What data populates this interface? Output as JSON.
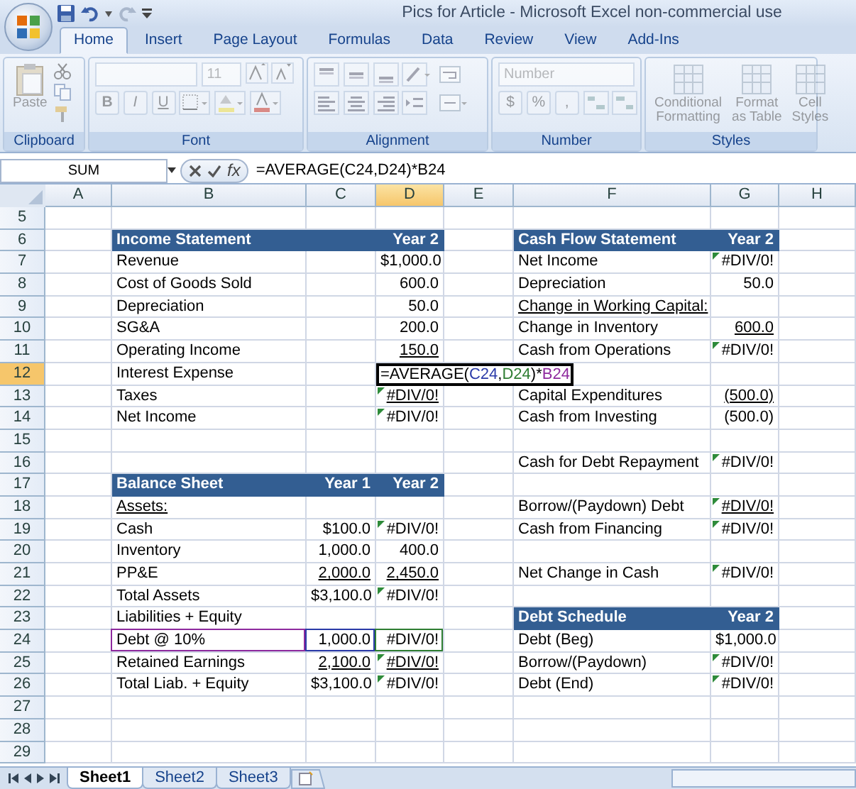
{
  "window": {
    "title": "Pics for Article - Microsoft Excel non-commercial use"
  },
  "tabs": [
    {
      "label": "Home",
      "selected": true
    },
    {
      "label": "Insert",
      "selected": false
    },
    {
      "label": "Page Layout",
      "selected": false
    },
    {
      "label": "Formulas",
      "selected": false
    },
    {
      "label": "Data",
      "selected": false
    },
    {
      "label": "Review",
      "selected": false
    },
    {
      "label": "View",
      "selected": false
    },
    {
      "label": "Add-Ins",
      "selected": false
    }
  ],
  "ribbon": {
    "disabled": true,
    "groups": [
      {
        "kind": "clipboard",
        "label": "Clipboard",
        "paste": "Paste"
      },
      {
        "kind": "font",
        "label": "Font",
        "font_size": "11",
        "bold": "B",
        "italic": "I",
        "underline": "U"
      },
      {
        "kind": "alignment",
        "label": "Alignment"
      },
      {
        "kind": "number",
        "label": "Number",
        "format": "Number",
        "currency": "$",
        "percent": "%",
        "comma": ","
      },
      {
        "kind": "styles",
        "label": "Styles",
        "buttons": [
          [
            "Conditional",
            "Formatting"
          ],
          [
            "Format",
            "as Table"
          ],
          [
            "Cell",
            "Styles"
          ]
        ]
      }
    ]
  },
  "formula_bar": {
    "name_box": "SUM",
    "fx": "fx",
    "formula": "=AVERAGE(C24,D24)*B24"
  },
  "columns": [
    {
      "label": "A",
      "selected": false
    },
    {
      "label": "B",
      "selected": false
    },
    {
      "label": "C",
      "selected": false
    },
    {
      "label": "D",
      "selected": true
    },
    {
      "label": "E",
      "selected": false
    },
    {
      "label": "F",
      "selected": false
    },
    {
      "label": "G",
      "selected": false
    },
    {
      "label": "H",
      "selected": false
    }
  ],
  "grid": {
    "rows": [
      {
        "row": "5",
        "selected": false,
        "cells": []
      },
      {
        "row": "6",
        "selected": false,
        "cells": [
          "",
          {
            "kind": "header",
            "text": "Income Statement"
          },
          {
            "kind": "header"
          },
          {
            "kind": "header",
            "text": "Year 2"
          },
          "",
          {
            "kind": "header",
            "text": "Cash Flow Statement"
          },
          {
            "kind": "header",
            "text": "Year 2"
          }
        ]
      },
      {
        "row": "7",
        "selected": false,
        "cells": [
          "",
          {
            "kind": "label",
            "text": "Revenue"
          },
          "",
          {
            "kind": "number",
            "text": "$1,000.0"
          },
          "",
          {
            "kind": "label",
            "text": "Net Income"
          },
          {
            "kind": "number",
            "text": "#DIV/0!",
            "flag": true
          }
        ]
      },
      {
        "row": "8",
        "selected": false,
        "cells": [
          "",
          {
            "kind": "label",
            "text": "Cost of Goods Sold"
          },
          "",
          {
            "kind": "number",
            "text": "600.0"
          },
          "",
          {
            "kind": "label",
            "text": "Depreciation"
          },
          {
            "kind": "number",
            "text": "50.0"
          }
        ]
      },
      {
        "row": "9",
        "selected": false,
        "cells": [
          "",
          {
            "kind": "label",
            "text": "Depreciation"
          },
          "",
          {
            "kind": "number",
            "text": "50.0"
          },
          "",
          {
            "kind": "label",
            "text": "Change in Working Capital:",
            "underline": true
          }
        ]
      },
      {
        "row": "10",
        "selected": false,
        "cells": [
          "",
          {
            "kind": "label",
            "text": "SG&A"
          },
          "",
          {
            "kind": "number",
            "text": "200.0"
          },
          "",
          {
            "kind": "label",
            "text": "Change in Inventory"
          },
          {
            "kind": "number",
            "text": "600.0",
            "underline": true
          }
        ]
      },
      {
        "row": "11",
        "selected": false,
        "cells": [
          "",
          {
            "kind": "label",
            "text": "Operating Income"
          },
          "",
          {
            "kind": "number",
            "text": "150.0",
            "underline": true
          },
          "",
          {
            "kind": "label",
            "text": "Cash from Operations"
          },
          {
            "kind": "number",
            "text": "#DIV/0!",
            "flag": true
          }
        ]
      },
      {
        "row": "12",
        "selected": true,
        "cells": [
          "",
          {
            "kind": "label",
            "text": "Interest Expense"
          },
          "",
          {
            "kind": "editing",
            "parts": [
              {
                "text": "=AVERAGE(",
                "color": "#000000"
              },
              {
                "text": "C24",
                "color": "#2a3aa8"
              },
              {
                "text": ",",
                "color": "#000000"
              },
              {
                "text": "D24",
                "color": "#2e7d32"
              },
              {
                "text": ")*",
                "color": "#000000"
              },
              {
                "text": "B24",
                "color": "#8e2a9e"
              }
            ]
          }
        ]
      },
      {
        "row": "13",
        "selected": false,
        "cells": [
          "",
          {
            "kind": "label",
            "text": "Taxes"
          },
          "",
          {
            "kind": "number",
            "text": "#DIV/0!",
            "underline": true,
            "flag": true
          },
          "",
          {
            "kind": "label",
            "text": "Capital Expenditures"
          },
          {
            "kind": "number",
            "text": "(500.0)",
            "underline": true
          }
        ]
      },
      {
        "row": "14",
        "selected": false,
        "cells": [
          "",
          {
            "kind": "label",
            "text": "Net Income"
          },
          "",
          {
            "kind": "number",
            "text": "#DIV/0!",
            "flag": true
          },
          "",
          {
            "kind": "label",
            "text": "Cash from Investing"
          },
          {
            "kind": "number",
            "text": "(500.0)"
          }
        ]
      },
      {
        "row": "15",
        "selected": false,
        "cells": []
      },
      {
        "row": "16",
        "selected": false,
        "cells": [
          "",
          "",
          "",
          "",
          "",
          {
            "kind": "label",
            "text": "Cash for Debt Repayment"
          },
          {
            "kind": "number",
            "text": "#DIV/0!",
            "flag": true
          }
        ]
      },
      {
        "row": "17",
        "selected": false,
        "cells": [
          "",
          {
            "kind": "header",
            "text": "Balance Sheet"
          },
          {
            "kind": "header",
            "text": "Year 1"
          },
          {
            "kind": "header",
            "text": "Year 2"
          }
        ]
      },
      {
        "row": "18",
        "selected": false,
        "cells": [
          "",
          {
            "kind": "label",
            "text": "Assets:",
            "underline": true
          },
          "",
          "",
          "",
          {
            "kind": "label",
            "text": "Borrow/(Paydown) Debt"
          },
          {
            "kind": "number",
            "text": "#DIV/0!",
            "underline": true,
            "flag": true
          }
        ]
      },
      {
        "row": "19",
        "selected": false,
        "cells": [
          "",
          {
            "kind": "label",
            "text": "Cash"
          },
          {
            "kind": "number",
            "text": "$100.0"
          },
          {
            "kind": "number",
            "text": "#DIV/0!",
            "flag": true
          },
          "",
          {
            "kind": "label",
            "text": "Cash from Financing"
          },
          {
            "kind": "number",
            "text": "#DIV/0!",
            "flag": true
          }
        ]
      },
      {
        "row": "20",
        "selected": false,
        "cells": [
          "",
          {
            "kind": "label",
            "text": "Inventory"
          },
          {
            "kind": "number",
            "text": "1,000.0"
          },
          {
            "kind": "number",
            "text": "400.0"
          }
        ]
      },
      {
        "row": "21",
        "selected": false,
        "cells": [
          "",
          {
            "kind": "label",
            "text": "PP&E"
          },
          {
            "kind": "number",
            "text": "2,000.0",
            "underline": true
          },
          {
            "kind": "number",
            "text": "2,450.0",
            "underline": true
          },
          "",
          {
            "kind": "label",
            "text": "Net Change in Cash"
          },
          {
            "kind": "number",
            "text": "#DIV/0!",
            "flag": true
          }
        ]
      },
      {
        "row": "22",
        "selected": false,
        "cells": [
          "",
          {
            "kind": "label",
            "text": "Total Assets"
          },
          {
            "kind": "number",
            "text": "$3,100.0"
          },
          {
            "kind": "number",
            "text": "#DIV/0!",
            "flag": true
          }
        ]
      },
      {
        "row": "23",
        "selected": false,
        "cells": [
          "",
          {
            "kind": "label",
            "text": "Liabilities + Equity"
          },
          "",
          "",
          "",
          {
            "kind": "header",
            "text": "Debt Schedule"
          },
          {
            "kind": "header",
            "text": "Year 2"
          }
        ]
      },
      {
        "row": "24",
        "selected": false,
        "cells": [
          "",
          {
            "kind": "label",
            "text": "Debt @ 10%",
            "color": "#8e2a9e"
          },
          {
            "kind": "number",
            "text": "1,000.0",
            "color": "#2a3aa8"
          },
          {
            "kind": "number",
            "text": "#DIV/0!",
            "color": "#2e7d32"
          },
          "",
          {
            "kind": "label",
            "text": "Debt (Beg)"
          },
          {
            "kind": "number",
            "text": "$1,000.0"
          }
        ]
      },
      {
        "row": "25",
        "selected": false,
        "cells": [
          "",
          {
            "kind": "label",
            "text": "Retained Earnings"
          },
          {
            "kind": "number",
            "text": "2,100.0",
            "underline": true
          },
          {
            "kind": "number",
            "text": "#DIV/0!",
            "underline": true,
            "flag": true
          },
          "",
          {
            "kind": "label",
            "text": "Borrow/(Paydown)"
          },
          {
            "kind": "number",
            "text": "#DIV/0!",
            "flag": true
          }
        ]
      },
      {
        "row": "26",
        "selected": false,
        "cells": [
          "",
          {
            "kind": "label",
            "text": "Total Liab. + Equity"
          },
          {
            "kind": "number",
            "text": "$3,100.0"
          },
          {
            "kind": "number",
            "text": "#DIV/0!",
            "flag": true
          },
          "",
          {
            "kind": "label",
            "text": "Debt (End)"
          },
          {
            "kind": "number",
            "text": "#DIV/0!",
            "flag": true
          }
        ]
      },
      {
        "row": "27",
        "selected": false,
        "cells": []
      },
      {
        "row": "28",
        "selected": false,
        "cells": []
      },
      {
        "row": "29",
        "selected": false,
        "cells": []
      }
    ]
  },
  "sheets": [
    {
      "label": "Sheet1",
      "selected": true
    },
    {
      "label": "Sheet2",
      "selected": false
    },
    {
      "label": "Sheet3",
      "selected": false
    }
  ]
}
